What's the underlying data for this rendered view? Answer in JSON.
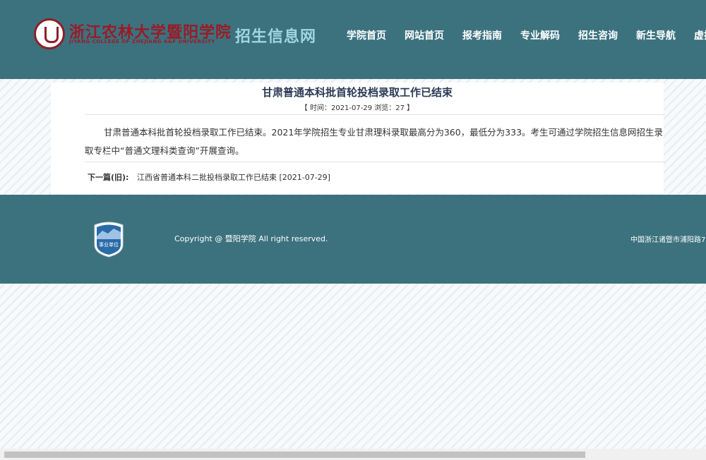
{
  "header": {
    "logo": {
      "name_cn": "浙江农林大学暨阳学院",
      "name_en": "JIYANG COLLEGE OF ZHEJIANG A&F UNIVERSITY"
    },
    "site_title": "招生信息网",
    "nav": [
      {
        "label": "学院首页"
      },
      {
        "label": "网站首页"
      },
      {
        "label": "报考指南"
      },
      {
        "label": "专业解码"
      },
      {
        "label": "招生咨询"
      },
      {
        "label": "新生导航"
      },
      {
        "label": "虚拟"
      }
    ]
  },
  "article": {
    "title": "甘肃普通本科批首轮投档录取工作已结束",
    "meta": "【 时间：2021-07-29 浏览：27 】",
    "body": "甘肃普通本科批首轮投档录取工作已结束。2021年学院招生专业甘肃理科录取最高分为360，最低分为333。考生可通过学院招生信息网招生录取专栏中“普通文理科类查询”开展查询。",
    "next_label": "下一篇(旧):",
    "next_link": "江西省普通本科二批投档录取工作已结束 [2021-07-29]"
  },
  "footer": {
    "badge_text": "事业单位",
    "copyright": "Copyright @ 暨阳学院 All right reserved.",
    "address": "中国浙江诸暨市浦阳路7"
  },
  "colors": {
    "header_bg": "#3b727e",
    "footer_bg": "#3b727e",
    "title_color": "#2b3a55",
    "logo_red": "#9a1b26",
    "site_title_color": "#9fd6e0"
  }
}
